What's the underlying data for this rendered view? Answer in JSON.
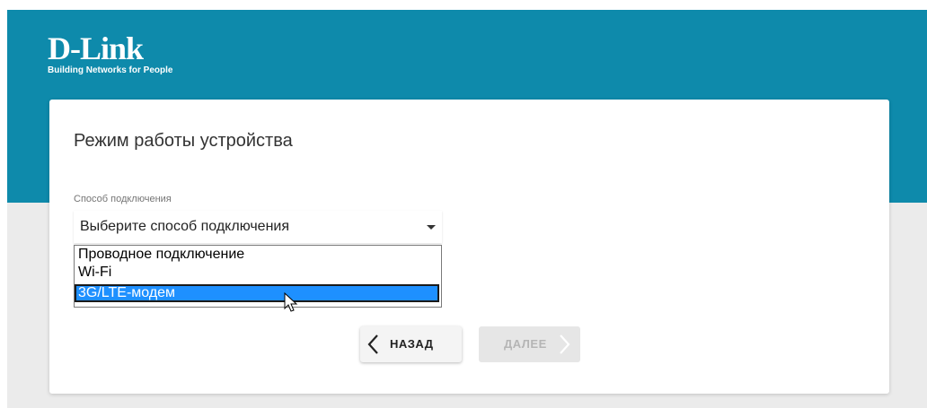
{
  "brand": {
    "name": "D-Link",
    "tagline": "Building Networks for People"
  },
  "page": {
    "title": "Режим работы устройства"
  },
  "connection": {
    "label": "Способ подключения",
    "selected_value": "Выберите способ подключения",
    "options": [
      {
        "label": "Проводное подключение",
        "highlighted": false
      },
      {
        "label": "Wi-Fi",
        "highlighted": false
      },
      {
        "label": "3G/LTE-модем",
        "highlighted": true
      }
    ]
  },
  "buttons": {
    "back_label": "НАЗАД",
    "next_label": "ДАЛЕЕ"
  },
  "colors": {
    "header_band": "#0e8aab",
    "option_highlight": "#1e90ff",
    "page_background": "#ebebeb"
  },
  "icons": {
    "caret": "chevron-down-icon",
    "back": "chevron-left-icon",
    "next": "chevron-right-icon",
    "cursor": "mouse-pointer-icon"
  }
}
